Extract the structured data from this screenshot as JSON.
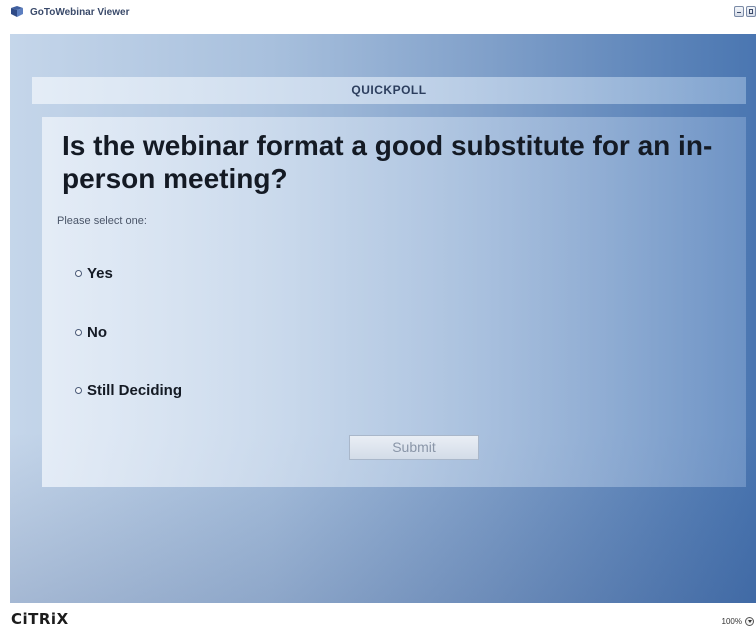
{
  "window": {
    "title": "GoToWebinar Viewer"
  },
  "poll": {
    "header": "QUICKPOLL",
    "question": "Is the webinar format a good substitute for an in-person meeting?",
    "instruction": "Please select one:",
    "options": [
      {
        "label": "Yes",
        "selected": false
      },
      {
        "label": "No",
        "selected": false
      },
      {
        "label": "Still Deciding",
        "selected": false
      }
    ],
    "submit_label": "Submit",
    "submit_enabled": false
  },
  "statusbar": {
    "logo": "CiTRiX",
    "zoom": "100%"
  },
  "icons": {
    "app": "gotowebinar-icon",
    "minimize": "minimize-icon",
    "maximize": "maximize-icon",
    "zoom": "chevron-down-icon",
    "radio": "radio-empty-icon"
  },
  "colors": {
    "gradient_left": "#c5d6ea",
    "gradient_right": "#4a76b1",
    "text_dark": "#141a24",
    "title_text": "#3a4a6a"
  }
}
